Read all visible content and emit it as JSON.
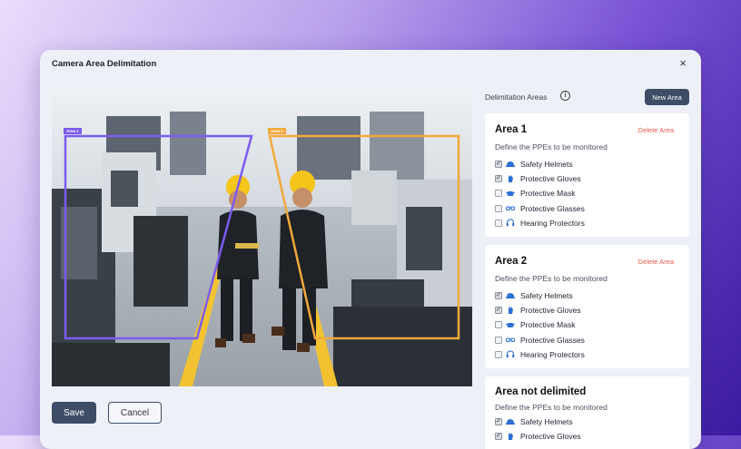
{
  "modal": {
    "title": "Camera Area Delimitation",
    "close_symbol": "×"
  },
  "camera": {
    "zone_tags": [
      "Area 1",
      "Area 2"
    ]
  },
  "colors": {
    "area1": "#7a5cf0",
    "area2": "#f2a93b",
    "button": "#3e4d66",
    "delete": "#e8594a"
  },
  "buttons": {
    "save": "Save",
    "cancel": "Cancel"
  },
  "panel": {
    "title": "Delimitation Areas",
    "info_symbol": "i",
    "new_area": "New Area"
  },
  "cards": [
    {
      "name": "Area 1",
      "delete_label": "Delete Area",
      "subtitle": "Define the PPEs to be monitored",
      "items": [
        {
          "label": "Safety Helmets",
          "checked": true,
          "icon": "helmet-icon"
        },
        {
          "label": "Protective Gloves",
          "checked": true,
          "icon": "glove-icon"
        },
        {
          "label": "Protective Mask",
          "checked": false,
          "icon": "mask-icon"
        },
        {
          "label": "Protective Glasses",
          "checked": false,
          "icon": "glasses-icon"
        },
        {
          "label": "Hearing Protectors",
          "checked": false,
          "icon": "headphones-icon"
        }
      ]
    },
    {
      "name": "Area 2",
      "delete_label": "Delete Area",
      "subtitle": "Define the PPEs to be monitored",
      "items": [
        {
          "label": "Safety Helmets",
          "checked": true,
          "icon": "helmet-icon"
        },
        {
          "label": "Protective Gloves",
          "checked": true,
          "icon": "glove-icon"
        },
        {
          "label": "Protective Mask",
          "checked": false,
          "icon": "mask-icon"
        },
        {
          "label": "Protective Glasses",
          "checked": false,
          "icon": "glasses-icon"
        },
        {
          "label": "Hearing Protectors",
          "checked": false,
          "icon": "headphones-icon"
        }
      ]
    },
    {
      "name": "Area not delimited",
      "subtitle": "Define the PPEs to be monitored",
      "items": [
        {
          "label": "Safety Helmets",
          "checked": true,
          "icon": "helmet-icon"
        },
        {
          "label": "Protective Gloves",
          "checked": true,
          "icon": "glove-icon"
        }
      ]
    }
  ]
}
